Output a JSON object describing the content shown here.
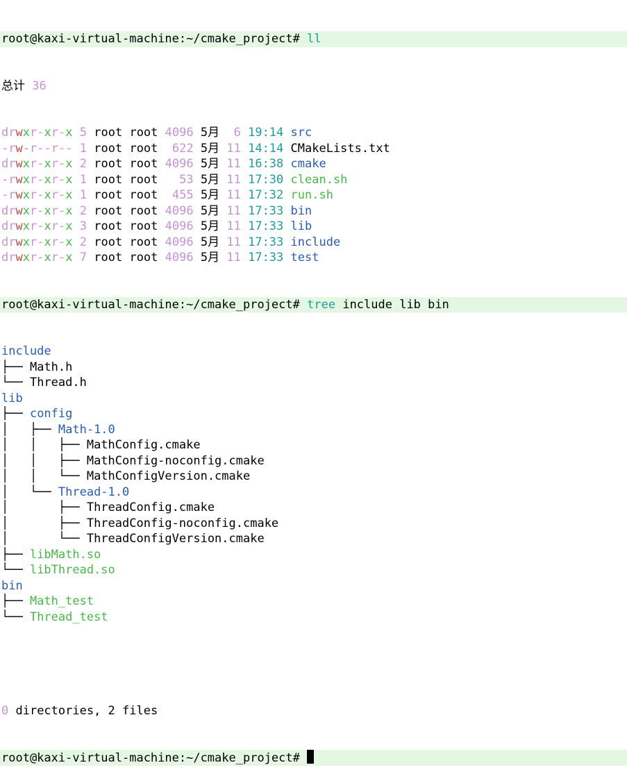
{
  "terminal": {
    "prompt": "root@kaxi-virtual-machine:~/cmake_project#",
    "cmd1": "ll",
    "total_label": "总计",
    "total_value": "36",
    "listing": [
      {
        "perms": "drwxr-xr-x",
        "links": "5",
        "owner": "root",
        "group": "root",
        "size": "4096",
        "month": "5月",
        "day": " 6",
        "time": "19:14",
        "name": "src",
        "kind": "dir"
      },
      {
        "perms": "-rw-r--r--",
        "links": "1",
        "owner": "root",
        "group": "root",
        "size": " 622",
        "month": "5月",
        "day": "11",
        "time": "14:14",
        "name": "CMakeLists.txt",
        "kind": "file"
      },
      {
        "perms": "drwxr-xr-x",
        "links": "2",
        "owner": "root",
        "group": "root",
        "size": "4096",
        "month": "5月",
        "day": "11",
        "time": "16:38",
        "name": "cmake",
        "kind": "dir"
      },
      {
        "perms": "-rwxr-xr-x",
        "links": "1",
        "owner": "root",
        "group": "root",
        "size": "  53",
        "month": "5月",
        "day": "11",
        "time": "17:30",
        "name": "clean.sh",
        "kind": "exec"
      },
      {
        "perms": "-rwxr-xr-x",
        "links": "1",
        "owner": "root",
        "group": "root",
        "size": " 455",
        "month": "5月",
        "day": "11",
        "time": "17:32",
        "name": "run.sh",
        "kind": "exec"
      },
      {
        "perms": "drwxr-xr-x",
        "links": "2",
        "owner": "root",
        "group": "root",
        "size": "4096",
        "month": "5月",
        "day": "11",
        "time": "17:33",
        "name": "bin",
        "kind": "dir"
      },
      {
        "perms": "drwxr-xr-x",
        "links": "3",
        "owner": "root",
        "group": "root",
        "size": "4096",
        "month": "5月",
        "day": "11",
        "time": "17:33",
        "name": "lib",
        "kind": "dir"
      },
      {
        "perms": "drwxr-xr-x",
        "links": "2",
        "owner": "root",
        "group": "root",
        "size": "4096",
        "month": "5月",
        "day": "11",
        "time": "17:33",
        "name": "include",
        "kind": "dir"
      },
      {
        "perms": "drwxr-xr-x",
        "links": "7",
        "owner": "root",
        "group": "root",
        "size": "4096",
        "month": "5月",
        "day": "11",
        "time": "17:33",
        "name": "test",
        "kind": "dir"
      }
    ],
    "cmd2_word": "tree",
    "cmd2_args": "include lib bin",
    "tree": [
      {
        "prefix": "",
        "name": "include",
        "kind": "dir"
      },
      {
        "prefix": "├── ",
        "name": "Math.h",
        "kind": "file"
      },
      {
        "prefix": "└── ",
        "name": "Thread.h",
        "kind": "file"
      },
      {
        "prefix": "",
        "name": "lib",
        "kind": "dir"
      },
      {
        "prefix": "├── ",
        "name": "config",
        "kind": "dir"
      },
      {
        "prefix": "│   ├── ",
        "name": "Math-1.0",
        "kind": "dir"
      },
      {
        "prefix": "│   │   ├── ",
        "name": "MathConfig.cmake",
        "kind": "file"
      },
      {
        "prefix": "│   │   ├── ",
        "name": "MathConfig-noconfig.cmake",
        "kind": "file"
      },
      {
        "prefix": "│   │   └── ",
        "name": "MathConfigVersion.cmake",
        "kind": "file"
      },
      {
        "prefix": "│   └── ",
        "name": "Thread-1.0",
        "kind": "dir"
      },
      {
        "prefix": "│       ├── ",
        "name": "ThreadConfig.cmake",
        "kind": "file"
      },
      {
        "prefix": "│       ├── ",
        "name": "ThreadConfig-noconfig.cmake",
        "kind": "file"
      },
      {
        "prefix": "│       └── ",
        "name": "ThreadConfigVersion.cmake",
        "kind": "file"
      },
      {
        "prefix": "├── ",
        "name": "libMath.so",
        "kind": "exec"
      },
      {
        "prefix": "└── ",
        "name": "libThread.so",
        "kind": "exec"
      },
      {
        "prefix": "",
        "name": "bin",
        "kind": "dir"
      },
      {
        "prefix": "├── ",
        "name": "Math_test",
        "kind": "exec"
      },
      {
        "prefix": "└── ",
        "name": "Thread_test",
        "kind": "exec"
      }
    ],
    "summary_count": "0",
    "summary_rest": " directories, 2 files",
    "colors": {
      "prompt_bg": "#e3f7e3",
      "dir": "#2a5db0",
      "exec": "#46b847",
      "number": "#c792d6",
      "time": "#1f9c9c",
      "perm_r": "#c792d6",
      "perm_w": "#c0504d",
      "perm_x": "#46b847"
    }
  }
}
